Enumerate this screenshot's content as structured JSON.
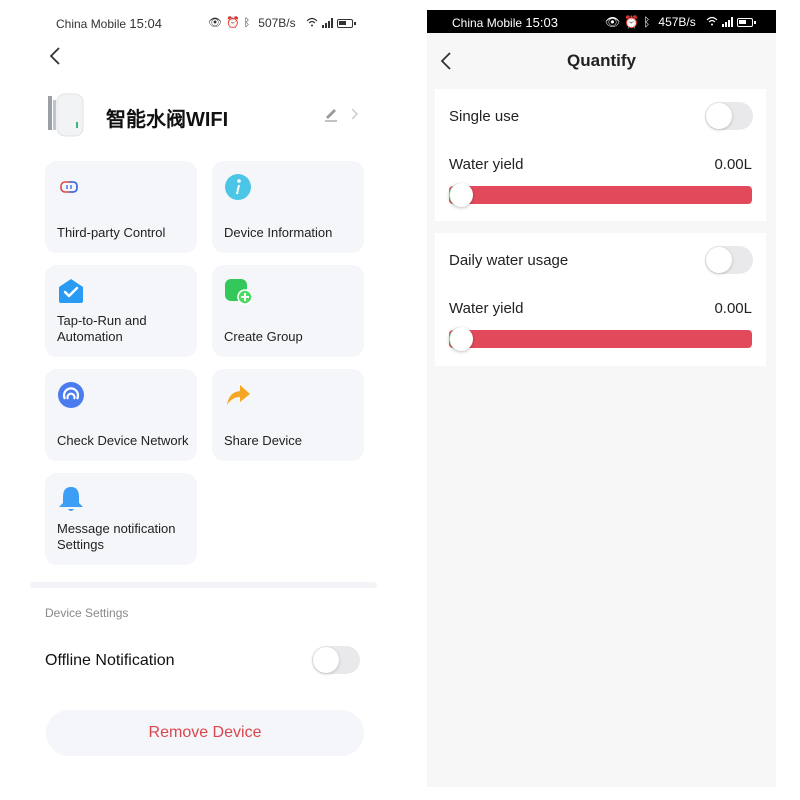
{
  "left_screen": {
    "status_bar": {
      "carrier": "China Mobile",
      "time": "15:04",
      "net_speed": "507B/s",
      "icons": [
        "eye-icon",
        "alarm-icon",
        "bluetooth-icon",
        "wifi-icon",
        "signal-icon",
        "battery-icon"
      ]
    },
    "device": {
      "name": "智能水阀WIFI",
      "image": "water-valve-device"
    },
    "tiles": [
      {
        "label": "Third-party Control",
        "icon": "third-party-control-icon",
        "color": "#d94a4a"
      },
      {
        "label": "Device Information",
        "icon": "info-icon",
        "color": "#4cc6e6"
      },
      {
        "label": "Tap-to-Run and Automation",
        "icon": "automation-check-icon",
        "color": "#2a9bf5"
      },
      {
        "label": "Create Group",
        "icon": "create-group-icon",
        "color": "#34c759"
      },
      {
        "label": "Check Device Network",
        "icon": "network-check-icon",
        "color": "#4a7cf0"
      },
      {
        "label": "Share Device",
        "icon": "share-icon",
        "color": "#f5a623"
      },
      {
        "label": "Message notification Settings",
        "icon": "bell-icon",
        "color": "#3d9ef5"
      }
    ],
    "device_settings": {
      "section_label": "Device Settings",
      "offline_notification_label": "Offline Notification",
      "offline_notification_enabled": false
    },
    "remove_button_label": "Remove Device",
    "colors": {
      "danger": "#d9474e",
      "tile_bg": "#f5f6fa"
    }
  },
  "right_screen": {
    "status_bar": {
      "carrier": "China Mobile",
      "time": "15:03",
      "net_speed": "457B/s"
    },
    "title": "Quantify",
    "sections": [
      {
        "toggle_label": "Single use",
        "toggle_enabled": false,
        "yield_label": "Water yield",
        "yield_value": "0.00L",
        "slider_fraction": 0
      },
      {
        "toggle_label": "Daily water usage",
        "toggle_enabled": false,
        "yield_label": "Water yield",
        "yield_value": "0.00L",
        "slider_fraction": 0
      }
    ],
    "colors": {
      "slider_track": "#e24a5b"
    }
  }
}
